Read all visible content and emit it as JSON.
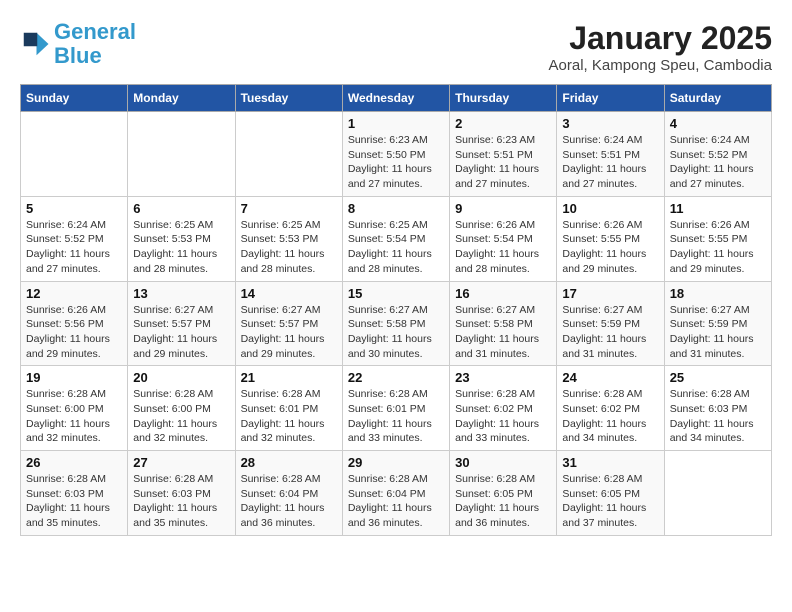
{
  "header": {
    "logo_line1": "General",
    "logo_line2": "Blue",
    "month": "January 2025",
    "location": "Aoral, Kampong Speu, Cambodia"
  },
  "weekdays": [
    "Sunday",
    "Monday",
    "Tuesday",
    "Wednesday",
    "Thursday",
    "Friday",
    "Saturday"
  ],
  "weeks": [
    [
      {
        "day": "",
        "sunrise": "",
        "sunset": "",
        "daylight": ""
      },
      {
        "day": "",
        "sunrise": "",
        "sunset": "",
        "daylight": ""
      },
      {
        "day": "",
        "sunrise": "",
        "sunset": "",
        "daylight": ""
      },
      {
        "day": "1",
        "sunrise": "Sunrise: 6:23 AM",
        "sunset": "Sunset: 5:50 PM",
        "daylight": "Daylight: 11 hours and 27 minutes."
      },
      {
        "day": "2",
        "sunrise": "Sunrise: 6:23 AM",
        "sunset": "Sunset: 5:51 PM",
        "daylight": "Daylight: 11 hours and 27 minutes."
      },
      {
        "day": "3",
        "sunrise": "Sunrise: 6:24 AM",
        "sunset": "Sunset: 5:51 PM",
        "daylight": "Daylight: 11 hours and 27 minutes."
      },
      {
        "day": "4",
        "sunrise": "Sunrise: 6:24 AM",
        "sunset": "Sunset: 5:52 PM",
        "daylight": "Daylight: 11 hours and 27 minutes."
      }
    ],
    [
      {
        "day": "5",
        "sunrise": "Sunrise: 6:24 AM",
        "sunset": "Sunset: 5:52 PM",
        "daylight": "Daylight: 11 hours and 27 minutes."
      },
      {
        "day": "6",
        "sunrise": "Sunrise: 6:25 AM",
        "sunset": "Sunset: 5:53 PM",
        "daylight": "Daylight: 11 hours and 28 minutes."
      },
      {
        "day": "7",
        "sunrise": "Sunrise: 6:25 AM",
        "sunset": "Sunset: 5:53 PM",
        "daylight": "Daylight: 11 hours and 28 minutes."
      },
      {
        "day": "8",
        "sunrise": "Sunrise: 6:25 AM",
        "sunset": "Sunset: 5:54 PM",
        "daylight": "Daylight: 11 hours and 28 minutes."
      },
      {
        "day": "9",
        "sunrise": "Sunrise: 6:26 AM",
        "sunset": "Sunset: 5:54 PM",
        "daylight": "Daylight: 11 hours and 28 minutes."
      },
      {
        "day": "10",
        "sunrise": "Sunrise: 6:26 AM",
        "sunset": "Sunset: 5:55 PM",
        "daylight": "Daylight: 11 hours and 29 minutes."
      },
      {
        "day": "11",
        "sunrise": "Sunrise: 6:26 AM",
        "sunset": "Sunset: 5:55 PM",
        "daylight": "Daylight: 11 hours and 29 minutes."
      }
    ],
    [
      {
        "day": "12",
        "sunrise": "Sunrise: 6:26 AM",
        "sunset": "Sunset: 5:56 PM",
        "daylight": "Daylight: 11 hours and 29 minutes."
      },
      {
        "day": "13",
        "sunrise": "Sunrise: 6:27 AM",
        "sunset": "Sunset: 5:57 PM",
        "daylight": "Daylight: 11 hours and 29 minutes."
      },
      {
        "day": "14",
        "sunrise": "Sunrise: 6:27 AM",
        "sunset": "Sunset: 5:57 PM",
        "daylight": "Daylight: 11 hours and 29 minutes."
      },
      {
        "day": "15",
        "sunrise": "Sunrise: 6:27 AM",
        "sunset": "Sunset: 5:58 PM",
        "daylight": "Daylight: 11 hours and 30 minutes."
      },
      {
        "day": "16",
        "sunrise": "Sunrise: 6:27 AM",
        "sunset": "Sunset: 5:58 PM",
        "daylight": "Daylight: 11 hours and 31 minutes."
      },
      {
        "day": "17",
        "sunrise": "Sunrise: 6:27 AM",
        "sunset": "Sunset: 5:59 PM",
        "daylight": "Daylight: 11 hours and 31 minutes."
      },
      {
        "day": "18",
        "sunrise": "Sunrise: 6:27 AM",
        "sunset": "Sunset: 5:59 PM",
        "daylight": "Daylight: 11 hours and 31 minutes."
      }
    ],
    [
      {
        "day": "19",
        "sunrise": "Sunrise: 6:28 AM",
        "sunset": "Sunset: 6:00 PM",
        "daylight": "Daylight: 11 hours and 32 minutes."
      },
      {
        "day": "20",
        "sunrise": "Sunrise: 6:28 AM",
        "sunset": "Sunset: 6:00 PM",
        "daylight": "Daylight: 11 hours and 32 minutes."
      },
      {
        "day": "21",
        "sunrise": "Sunrise: 6:28 AM",
        "sunset": "Sunset: 6:01 PM",
        "daylight": "Daylight: 11 hours and 32 minutes."
      },
      {
        "day": "22",
        "sunrise": "Sunrise: 6:28 AM",
        "sunset": "Sunset: 6:01 PM",
        "daylight": "Daylight: 11 hours and 33 minutes."
      },
      {
        "day": "23",
        "sunrise": "Sunrise: 6:28 AM",
        "sunset": "Sunset: 6:02 PM",
        "daylight": "Daylight: 11 hours and 33 minutes."
      },
      {
        "day": "24",
        "sunrise": "Sunrise: 6:28 AM",
        "sunset": "Sunset: 6:02 PM",
        "daylight": "Daylight: 11 hours and 34 minutes."
      },
      {
        "day": "25",
        "sunrise": "Sunrise: 6:28 AM",
        "sunset": "Sunset: 6:03 PM",
        "daylight": "Daylight: 11 hours and 34 minutes."
      }
    ],
    [
      {
        "day": "26",
        "sunrise": "Sunrise: 6:28 AM",
        "sunset": "Sunset: 6:03 PM",
        "daylight": "Daylight: 11 hours and 35 minutes."
      },
      {
        "day": "27",
        "sunrise": "Sunrise: 6:28 AM",
        "sunset": "Sunset: 6:03 PM",
        "daylight": "Daylight: 11 hours and 35 minutes."
      },
      {
        "day": "28",
        "sunrise": "Sunrise: 6:28 AM",
        "sunset": "Sunset: 6:04 PM",
        "daylight": "Daylight: 11 hours and 36 minutes."
      },
      {
        "day": "29",
        "sunrise": "Sunrise: 6:28 AM",
        "sunset": "Sunset: 6:04 PM",
        "daylight": "Daylight: 11 hours and 36 minutes."
      },
      {
        "day": "30",
        "sunrise": "Sunrise: 6:28 AM",
        "sunset": "Sunset: 6:05 PM",
        "daylight": "Daylight: 11 hours and 36 minutes."
      },
      {
        "day": "31",
        "sunrise": "Sunrise: 6:28 AM",
        "sunset": "Sunset: 6:05 PM",
        "daylight": "Daylight: 11 hours and 37 minutes."
      },
      {
        "day": "",
        "sunrise": "",
        "sunset": "",
        "daylight": ""
      }
    ]
  ]
}
